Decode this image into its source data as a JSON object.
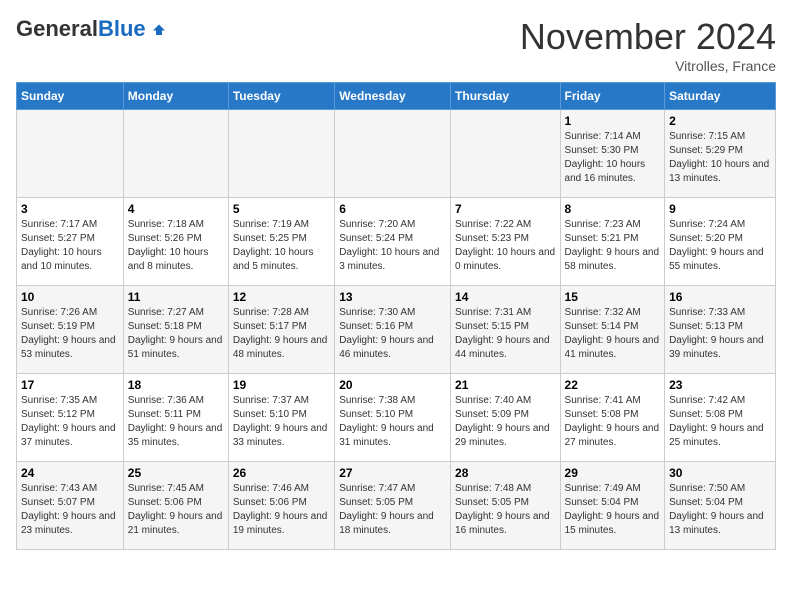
{
  "logo": {
    "general": "General",
    "blue": "Blue"
  },
  "title": "November 2024",
  "location": "Vitrolles, France",
  "days_of_week": [
    "Sunday",
    "Monday",
    "Tuesday",
    "Wednesday",
    "Thursday",
    "Friday",
    "Saturday"
  ],
  "weeks": [
    [
      {
        "day": "",
        "info": ""
      },
      {
        "day": "",
        "info": ""
      },
      {
        "day": "",
        "info": ""
      },
      {
        "day": "",
        "info": ""
      },
      {
        "day": "",
        "info": ""
      },
      {
        "day": "1",
        "info": "Sunrise: 7:14 AM\nSunset: 5:30 PM\nDaylight: 10 hours and 16 minutes."
      },
      {
        "day": "2",
        "info": "Sunrise: 7:15 AM\nSunset: 5:29 PM\nDaylight: 10 hours and 13 minutes."
      }
    ],
    [
      {
        "day": "3",
        "info": "Sunrise: 7:17 AM\nSunset: 5:27 PM\nDaylight: 10 hours and 10 minutes."
      },
      {
        "day": "4",
        "info": "Sunrise: 7:18 AM\nSunset: 5:26 PM\nDaylight: 10 hours and 8 minutes."
      },
      {
        "day": "5",
        "info": "Sunrise: 7:19 AM\nSunset: 5:25 PM\nDaylight: 10 hours and 5 minutes."
      },
      {
        "day": "6",
        "info": "Sunrise: 7:20 AM\nSunset: 5:24 PM\nDaylight: 10 hours and 3 minutes."
      },
      {
        "day": "7",
        "info": "Sunrise: 7:22 AM\nSunset: 5:23 PM\nDaylight: 10 hours and 0 minutes."
      },
      {
        "day": "8",
        "info": "Sunrise: 7:23 AM\nSunset: 5:21 PM\nDaylight: 9 hours and 58 minutes."
      },
      {
        "day": "9",
        "info": "Sunrise: 7:24 AM\nSunset: 5:20 PM\nDaylight: 9 hours and 55 minutes."
      }
    ],
    [
      {
        "day": "10",
        "info": "Sunrise: 7:26 AM\nSunset: 5:19 PM\nDaylight: 9 hours and 53 minutes."
      },
      {
        "day": "11",
        "info": "Sunrise: 7:27 AM\nSunset: 5:18 PM\nDaylight: 9 hours and 51 minutes."
      },
      {
        "day": "12",
        "info": "Sunrise: 7:28 AM\nSunset: 5:17 PM\nDaylight: 9 hours and 48 minutes."
      },
      {
        "day": "13",
        "info": "Sunrise: 7:30 AM\nSunset: 5:16 PM\nDaylight: 9 hours and 46 minutes."
      },
      {
        "day": "14",
        "info": "Sunrise: 7:31 AM\nSunset: 5:15 PM\nDaylight: 9 hours and 44 minutes."
      },
      {
        "day": "15",
        "info": "Sunrise: 7:32 AM\nSunset: 5:14 PM\nDaylight: 9 hours and 41 minutes."
      },
      {
        "day": "16",
        "info": "Sunrise: 7:33 AM\nSunset: 5:13 PM\nDaylight: 9 hours and 39 minutes."
      }
    ],
    [
      {
        "day": "17",
        "info": "Sunrise: 7:35 AM\nSunset: 5:12 PM\nDaylight: 9 hours and 37 minutes."
      },
      {
        "day": "18",
        "info": "Sunrise: 7:36 AM\nSunset: 5:11 PM\nDaylight: 9 hours and 35 minutes."
      },
      {
        "day": "19",
        "info": "Sunrise: 7:37 AM\nSunset: 5:10 PM\nDaylight: 9 hours and 33 minutes."
      },
      {
        "day": "20",
        "info": "Sunrise: 7:38 AM\nSunset: 5:10 PM\nDaylight: 9 hours and 31 minutes."
      },
      {
        "day": "21",
        "info": "Sunrise: 7:40 AM\nSunset: 5:09 PM\nDaylight: 9 hours and 29 minutes."
      },
      {
        "day": "22",
        "info": "Sunrise: 7:41 AM\nSunset: 5:08 PM\nDaylight: 9 hours and 27 minutes."
      },
      {
        "day": "23",
        "info": "Sunrise: 7:42 AM\nSunset: 5:08 PM\nDaylight: 9 hours and 25 minutes."
      }
    ],
    [
      {
        "day": "24",
        "info": "Sunrise: 7:43 AM\nSunset: 5:07 PM\nDaylight: 9 hours and 23 minutes."
      },
      {
        "day": "25",
        "info": "Sunrise: 7:45 AM\nSunset: 5:06 PM\nDaylight: 9 hours and 21 minutes."
      },
      {
        "day": "26",
        "info": "Sunrise: 7:46 AM\nSunset: 5:06 PM\nDaylight: 9 hours and 19 minutes."
      },
      {
        "day": "27",
        "info": "Sunrise: 7:47 AM\nSunset: 5:05 PM\nDaylight: 9 hours and 18 minutes."
      },
      {
        "day": "28",
        "info": "Sunrise: 7:48 AM\nSunset: 5:05 PM\nDaylight: 9 hours and 16 minutes."
      },
      {
        "day": "29",
        "info": "Sunrise: 7:49 AM\nSunset: 5:04 PM\nDaylight: 9 hours and 15 minutes."
      },
      {
        "day": "30",
        "info": "Sunrise: 7:50 AM\nSunset: 5:04 PM\nDaylight: 9 hours and 13 minutes."
      }
    ]
  ]
}
